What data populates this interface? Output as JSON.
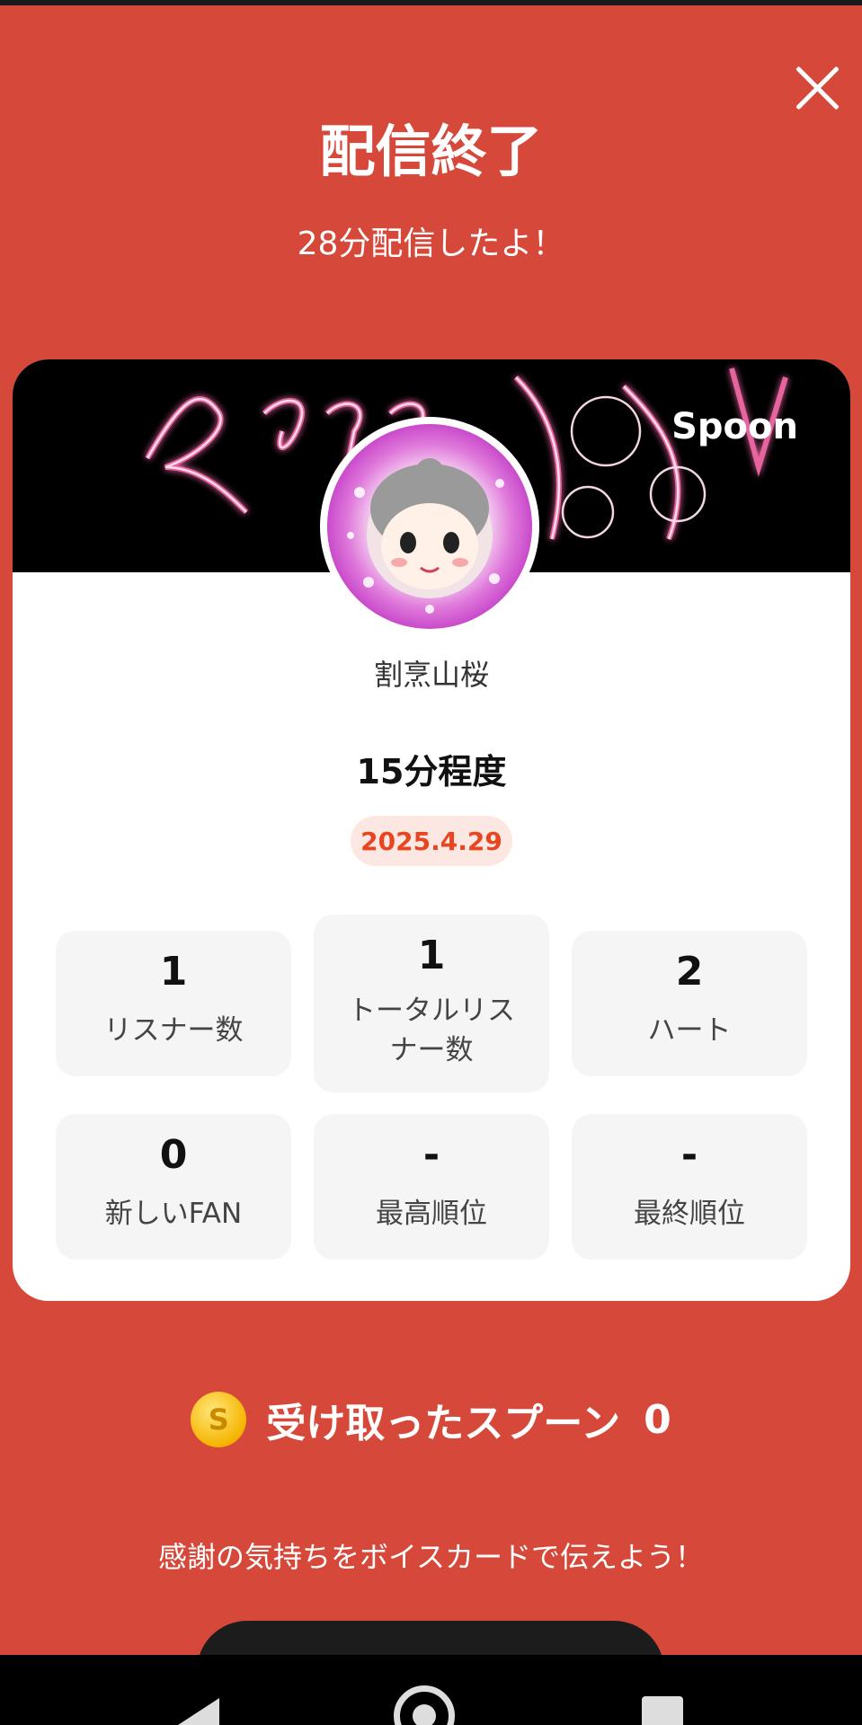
{
  "header": {
    "title": "配信終了",
    "subtitle": "28分配信したよ！"
  },
  "card": {
    "brand": "Spoon",
    "user_name": "割烹山桜",
    "duration": "15分程度",
    "date": "2025.4.29",
    "stats": [
      {
        "value": "1",
        "label": "リスナー数"
      },
      {
        "value": "1",
        "label_line1": "トータルリス",
        "label_line2": "ナー数"
      },
      {
        "value": "2",
        "label": "ハート"
      },
      {
        "value": "0",
        "label": "新しいFAN"
      },
      {
        "value": "-",
        "label": "最高順位"
      },
      {
        "value": "-",
        "label": "最終順位"
      }
    ]
  },
  "spoons": {
    "coin_symbol": "S",
    "label": "受け取ったスプーン",
    "count": "0"
  },
  "message": "感謝の気持ちをボイスカードで伝えよう！",
  "colors": {
    "background": "#D64839",
    "card": "#FFFFFF",
    "stat_box": "#F5F5F5",
    "date_badge_bg": "#FDE7E3",
    "date_badge_text": "#E8461F",
    "coin": "#F5B400"
  },
  "icons": {
    "close": "close-icon",
    "coin": "spoon-coin-icon",
    "nav_back": "back-triangle-icon",
    "nav_home": "home-circle-icon",
    "nav_recent": "recent-square-icon"
  }
}
